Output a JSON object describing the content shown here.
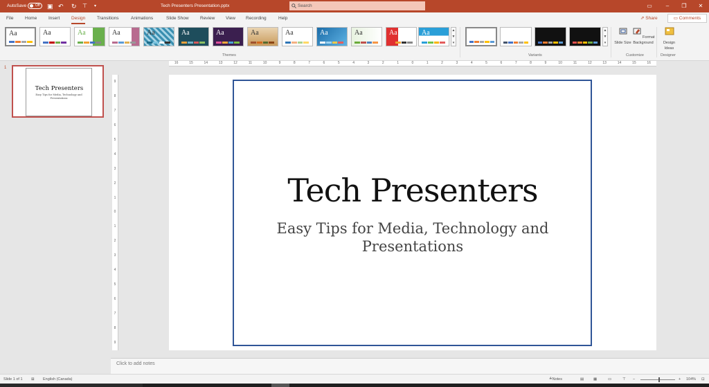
{
  "titlebar": {
    "autosave_label": "AutoSave",
    "autosave_state": "Off",
    "document_title": "Tech Presenters Presentation.pptx",
    "search_placeholder": "Search",
    "bg_color": "#b7472a",
    "window_controls": [
      "ribbon-display-icon",
      "minimize-icon",
      "restore-icon",
      "close-icon"
    ]
  },
  "menu": {
    "tabs": [
      "File",
      "Home",
      "Insert",
      "Design",
      "Transitions",
      "Animations",
      "Slide Show",
      "Review",
      "View",
      "Recording",
      "Help"
    ],
    "active_tab": "Design",
    "share_label": "Share",
    "comments_label": "Comments"
  },
  "ribbon": {
    "themes_label": "Themes",
    "variants_label": "Variants",
    "customize_label": "Customize",
    "designer_label": "Designer",
    "theme_sample_text": "Aa",
    "slide_size_label": "Slide Size",
    "format_background_label": "Format Background",
    "design_ideas_label": "Design Ideas"
  },
  "slides": [
    {
      "number": "1",
      "title": "Tech Presenters",
      "subtitle": "Easy Tips for Media, Technology and Presentations"
    }
  ],
  "slide": {
    "title": "Tech Presenters",
    "subtitle": "Easy Tips for Media, Technology and Presentations",
    "frame_color": "#2f5597"
  },
  "notes_placeholder": "Click to add notes",
  "rulers": {
    "horizontal": [
      "16",
      "15",
      "14",
      "13",
      "12",
      "11",
      "10",
      "9",
      "8",
      "7",
      "6",
      "5",
      "4",
      "3",
      "2",
      "1",
      "0",
      "1",
      "2",
      "3",
      "4",
      "5",
      "6",
      "7",
      "8",
      "9",
      "10",
      "11",
      "12",
      "13",
      "14",
      "15",
      "16"
    ],
    "vertical": [
      "9",
      "8",
      "7",
      "6",
      "5",
      "4",
      "3",
      "2",
      "1",
      "0",
      "1",
      "2",
      "3",
      "4",
      "5",
      "6",
      "7",
      "8",
      "9"
    ]
  },
  "status": {
    "slide_counter": "Slide 1 of 1",
    "language": "English (Canada)",
    "notes_label": "Notes",
    "zoom": "104%"
  }
}
